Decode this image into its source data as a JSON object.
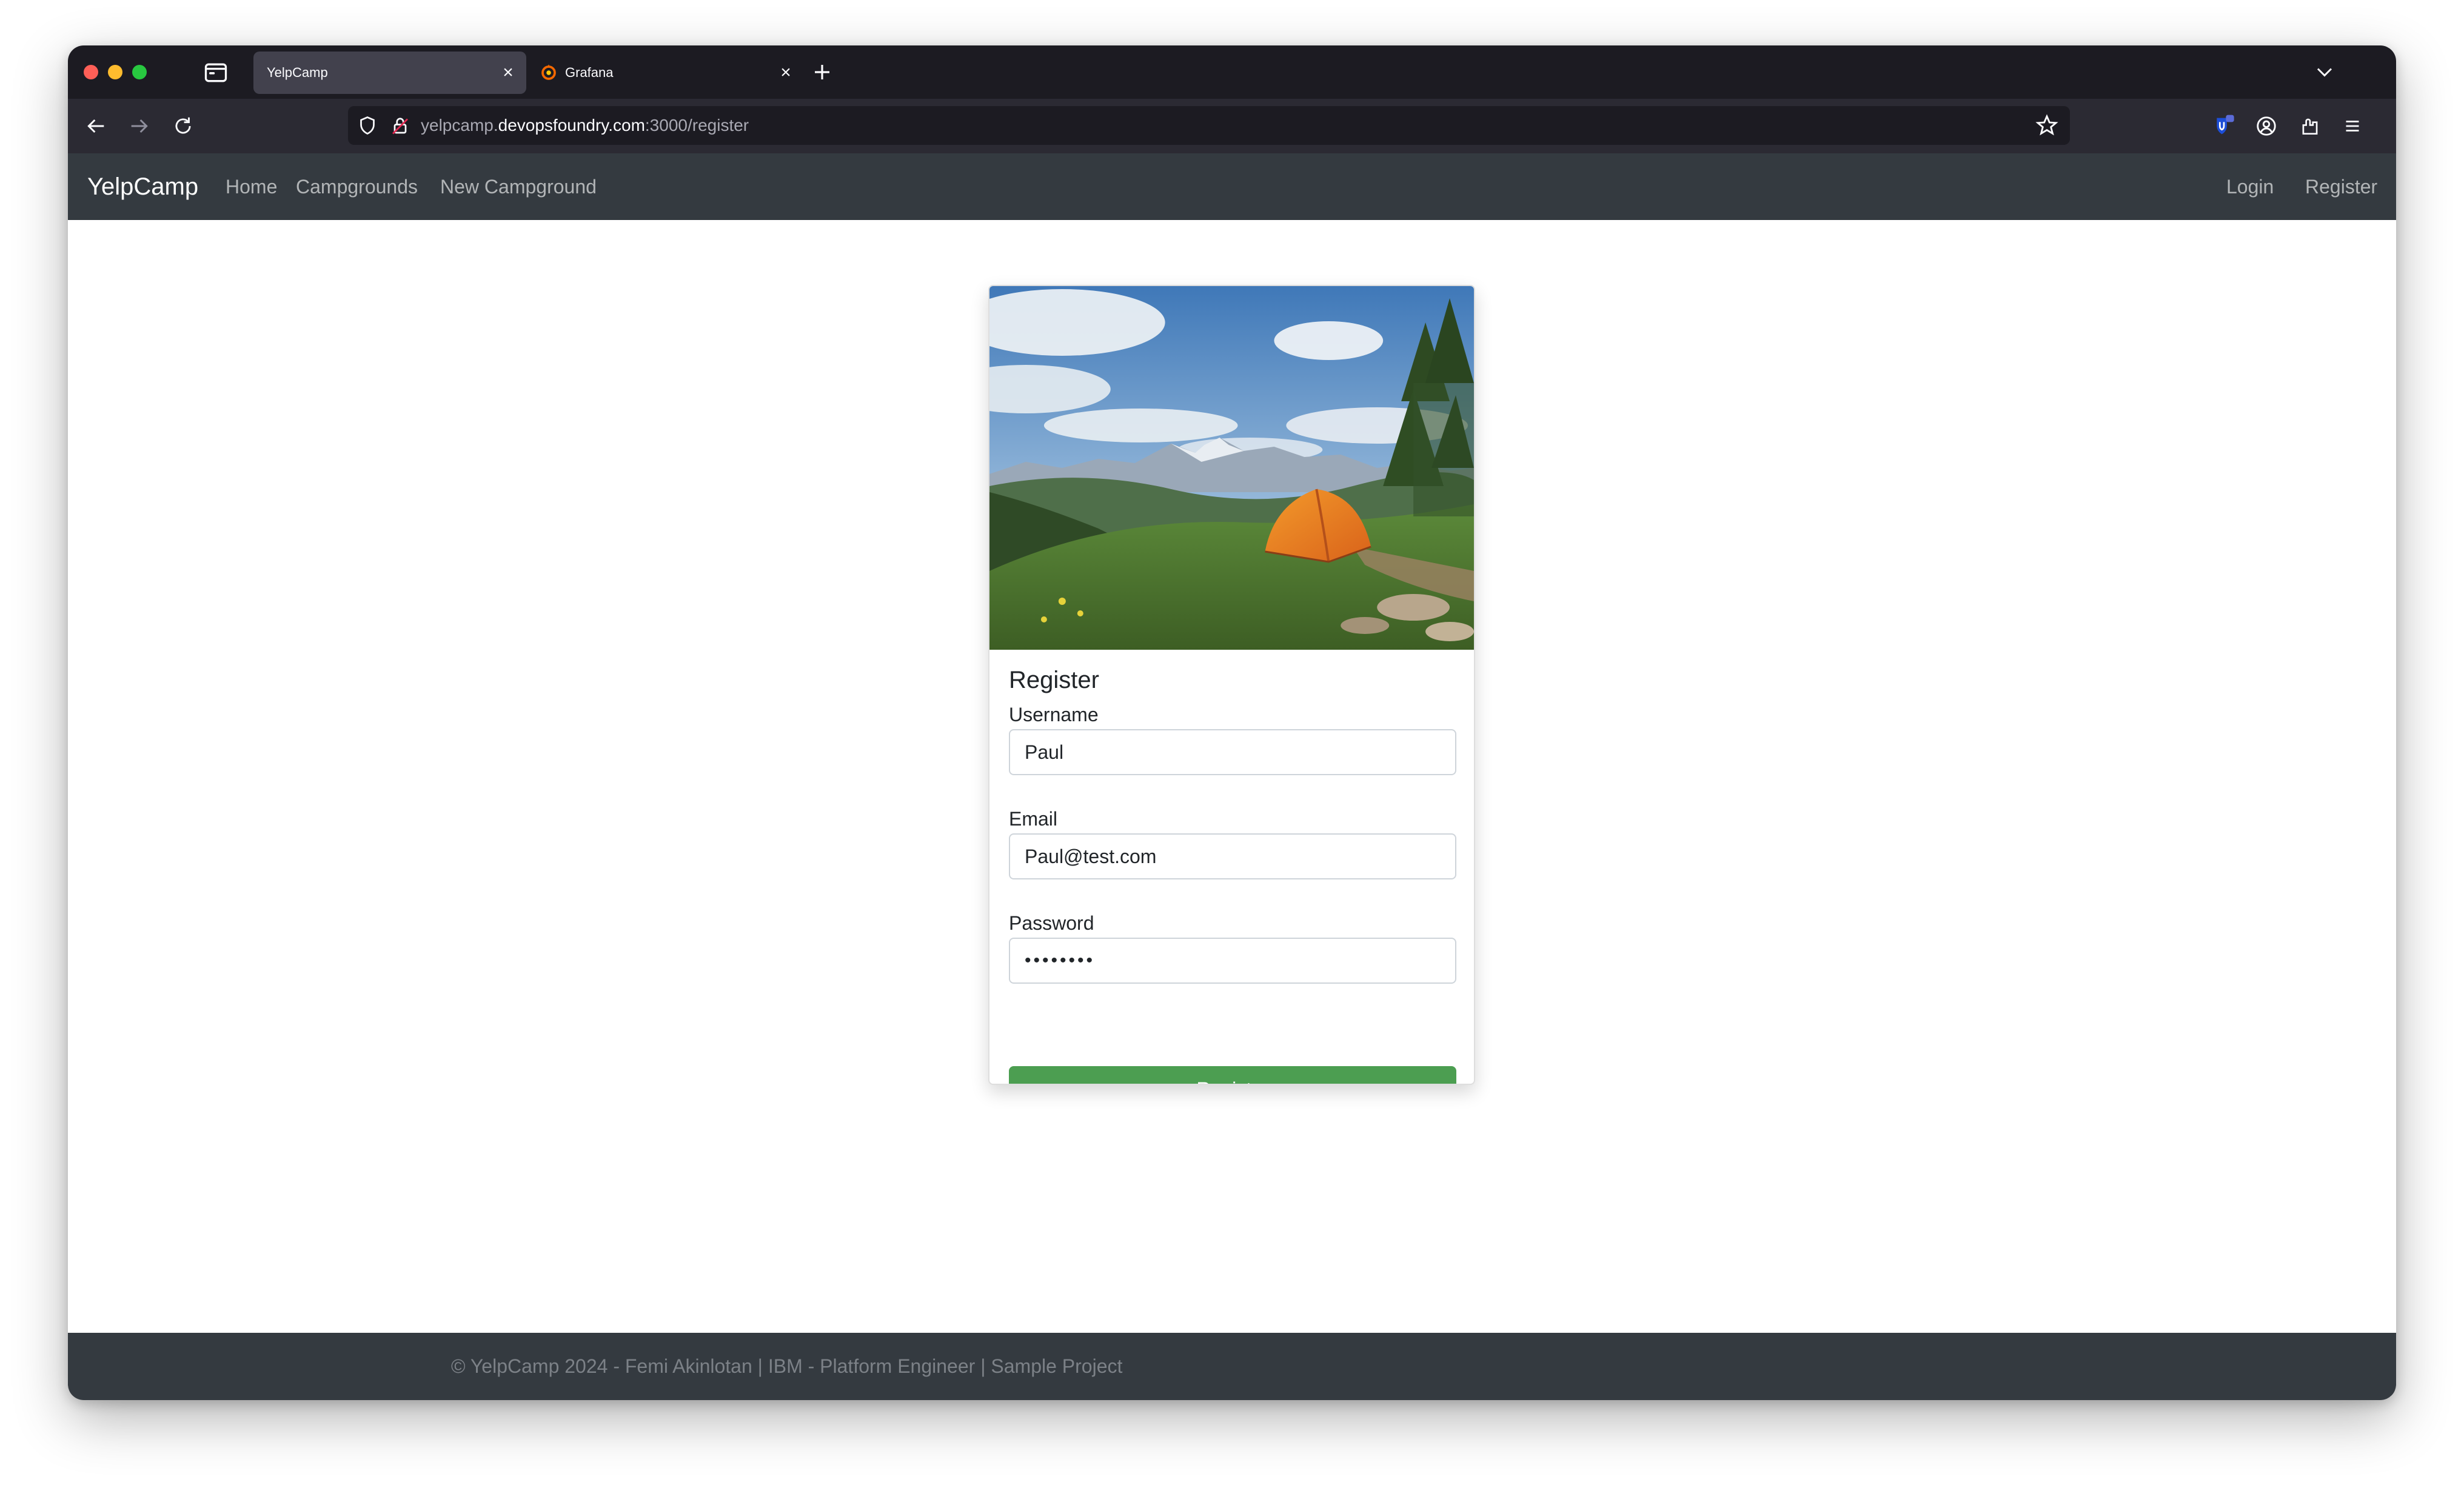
{
  "browser": {
    "tabs": [
      {
        "title": "YelpCamp",
        "active": true,
        "favicon": "none"
      },
      {
        "title": "Grafana",
        "active": false,
        "favicon": "grafana-logo"
      }
    ],
    "url": {
      "prefix": "yelpcamp.",
      "host": "devopsfoundry.com",
      "suffix": ":3000/register"
    },
    "icons": [
      "sidebar-icon",
      "back-icon",
      "forward-icon",
      "reload-icon",
      "shield-icon",
      "lock-icon",
      "star-icon",
      "extension-badge-icon",
      "account-icon",
      "extensions-icon",
      "menu-icon",
      "new-tab-icon",
      "chevron-down-icon"
    ],
    "colors": {
      "tabbar": "#1c1b22",
      "toolbar": "#2b2a33",
      "active_tab": "#42414d"
    }
  },
  "site_nav": {
    "brand": "YelpCamp",
    "links": [
      "Home",
      "Campgrounds",
      "New Campground"
    ],
    "right_links": [
      "Login",
      "Register"
    ]
  },
  "register_card": {
    "image": "orange tent on grassy hillside with mountains",
    "title": "Register",
    "username": {
      "label": "Username",
      "value": "Paul"
    },
    "email": {
      "label": "Email",
      "value": "Paul@test.com"
    },
    "password": {
      "label": "Password",
      "value": "••••••••"
    },
    "submit_label": "Register",
    "colors": {
      "button": "#4c9e51"
    }
  },
  "footer": {
    "text": "© YelpCamp 2024 - Femi Akinlotan | IBM - Platform Engineer | Sample Project"
  }
}
